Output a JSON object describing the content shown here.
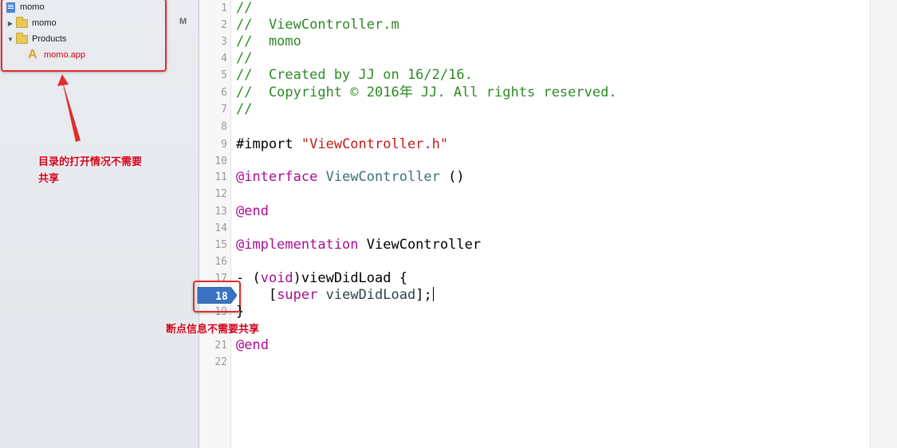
{
  "navigator": {
    "root_label": "momo",
    "group_momo_label": "momo",
    "group_products_label": "Products",
    "product_app_label": "momo.app",
    "status_badge": "M"
  },
  "annotations": {
    "navigator_note_line1": "目录的打开情况不需要",
    "navigator_note_line2": "共享",
    "breakpoint_note": "断点信息不需要共享"
  },
  "editor": {
    "line_numbers": [
      "1",
      "2",
      "3",
      "4",
      "5",
      "6",
      "7",
      "8",
      "9",
      "10",
      "11",
      "12",
      "13",
      "14",
      "15",
      "16",
      "17",
      "18",
      "19",
      "20",
      "21",
      "22"
    ],
    "breakpoint_line": "18",
    "code": {
      "l1": "//",
      "l2": "//  ViewController.m",
      "l3": "//  momo",
      "l4": "//",
      "l5": "//  Created by JJ on 16/2/16.",
      "l6": "//  Copyright © 2016年 JJ. All rights reserved.",
      "l7": "//",
      "l9_directive": "#import ",
      "l9_string": "\"ViewController.h\"",
      "l11_keyword": "@interface",
      "l11_class": "ViewController",
      "l11_rest": " ()",
      "l13_keyword": "@end",
      "l15_keyword": "@implementation",
      "l15_rest": " ViewController",
      "l17_prefix": "- (",
      "l17_type": "void",
      "l17_rest": ")viewDidLoad {",
      "l18_indent": "    [",
      "l18_keyword": "super",
      "l18_method": "viewDidLoad",
      "l18_rest": "];",
      "l19": "}",
      "l21_keyword": "@end"
    }
  },
  "colors": {
    "annotation_red": "#e02d2d",
    "comment_green": "#2d8a24",
    "keyword_purple": "#aa0d91",
    "string_red": "#c41a16",
    "class_teal": "#3f6e74",
    "breakpoint_blue": "#3a73c4"
  }
}
